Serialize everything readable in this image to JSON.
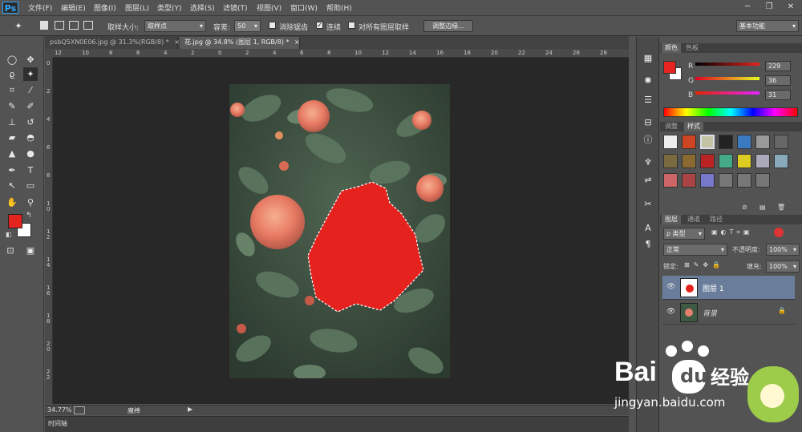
{
  "app": {
    "logo": "Ps"
  },
  "menu": [
    "文件(F)",
    "编辑(E)",
    "图像(I)",
    "图层(L)",
    "类型(Y)",
    "选择(S)",
    "滤镜(T)",
    "视图(V)",
    "窗口(W)",
    "帮助(H)"
  ],
  "window_controls": {
    "minimize": "─",
    "restore": "❐",
    "close": "✕"
  },
  "options": {
    "sample_size_label": "取样大小:",
    "sample_size_value": "取样点",
    "tolerance_label": "容差:",
    "tolerance_value": "50",
    "antialias_label": "消除锯齿",
    "contiguous_label": "连续",
    "contiguous_checked": "✓",
    "all_layers_label": "对所有图层取样",
    "refine_edge_label": "调整边缘...",
    "workspace_value": "基本功能"
  },
  "tabs": [
    {
      "label": "psbQ5XN0E06.jpg @ 31.3%(RGB/8) *",
      "close": "×"
    },
    {
      "label": "花.jpg @ 34.8% (图层 1, RGB/8) *",
      "close": "×"
    }
  ],
  "ruler": {
    "h": [
      "12",
      "10",
      "8",
      "6",
      "4",
      "2",
      "0",
      "2",
      "4",
      "6",
      "8",
      "10",
      "12",
      "14",
      "16",
      "18",
      "20",
      "22",
      "24",
      "26",
      "28"
    ],
    "v": [
      "0",
      "2",
      "4",
      "6",
      "8",
      "1\n0",
      "1\n2",
      "1\n4",
      "1\n6",
      "1\n8",
      "2\n0",
      "2\n2"
    ]
  },
  "status": {
    "zoom": "34.77%",
    "tool_name": "魔棒"
  },
  "timeline": {
    "label": "时间轴"
  },
  "colors": {
    "foreground": "#e5241f",
    "background": "#ffffff",
    "selection_fill": "#e5221e",
    "accent": "#31a8ff"
  },
  "color_panel": {
    "tabs": [
      "颜色",
      "色板"
    ],
    "r_label": "R",
    "r_value": "229",
    "g_label": "G",
    "g_value": "36",
    "b_label": "B",
    "b_value": "31"
  },
  "adjust_panel": {
    "tabs": [
      "调整",
      "样式"
    ]
  },
  "layers_panel": {
    "tabs": [
      "图层",
      "通道",
      "路径"
    ],
    "filter_label": "ρ 类型",
    "blend_mode": "正常",
    "opacity_label": "不透明度:",
    "opacity_value": "100%",
    "lock_label": "锁定:",
    "fill_label": "填充:",
    "fill_value": "100%",
    "layers": [
      {
        "name": "图层 1",
        "selected": true
      },
      {
        "name": "背景",
        "locked": true
      }
    ]
  },
  "watermark": {
    "brand": "Bai",
    "brand_cn": "经验",
    "url": "jingyan.baidu.com"
  }
}
